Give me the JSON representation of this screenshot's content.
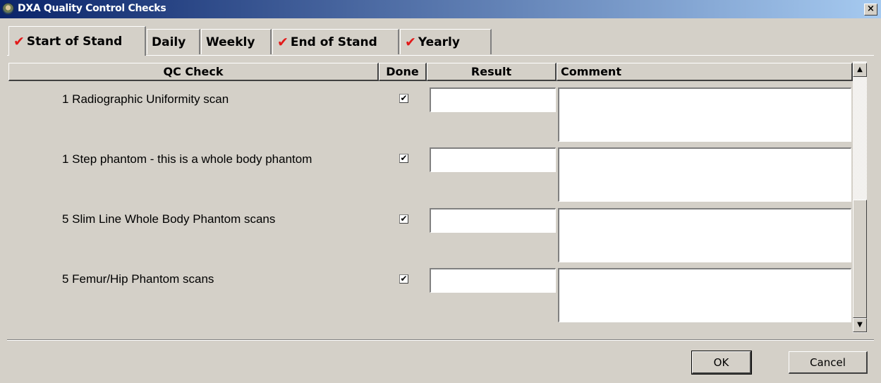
{
  "window": {
    "title": "DXA Quality Control Checks",
    "close_glyph": "×"
  },
  "tabs": [
    {
      "label": "Start of Stand",
      "checked": true,
      "active": true
    },
    {
      "label": "Daily",
      "checked": false,
      "active": false
    },
    {
      "label": "Weekly",
      "checked": false,
      "active": false
    },
    {
      "label": "End of Stand",
      "checked": true,
      "active": false
    },
    {
      "label": "Yearly",
      "checked": true,
      "active": false
    }
  ],
  "check_glyph": "✔",
  "grid": {
    "columns": {
      "qc_check": "QC Check",
      "done": "Done",
      "result": "Result",
      "comment": "Comment"
    },
    "rows": [
      {
        "qc_check": "1 Radiographic Uniformity scan",
        "done": true,
        "result": "",
        "comment": ""
      },
      {
        "qc_check": "1 Step phantom - this is a whole body phantom",
        "done": true,
        "result": "",
        "comment": ""
      },
      {
        "qc_check": "5 Slim Line Whole Body Phantom scans",
        "done": true,
        "result": "",
        "comment": ""
      },
      {
        "qc_check": "5 Femur/Hip Phantom scans",
        "done": true,
        "result": "",
        "comment": ""
      }
    ]
  },
  "scrollbar": {
    "up_glyph": "▲",
    "down_glyph": "▼"
  },
  "buttons": {
    "ok": "OK",
    "cancel": "Cancel"
  },
  "colors": {
    "check_accent": "#e21a1a",
    "titlebar_start": "#0a246a",
    "titlebar_end": "#a6caf0"
  }
}
